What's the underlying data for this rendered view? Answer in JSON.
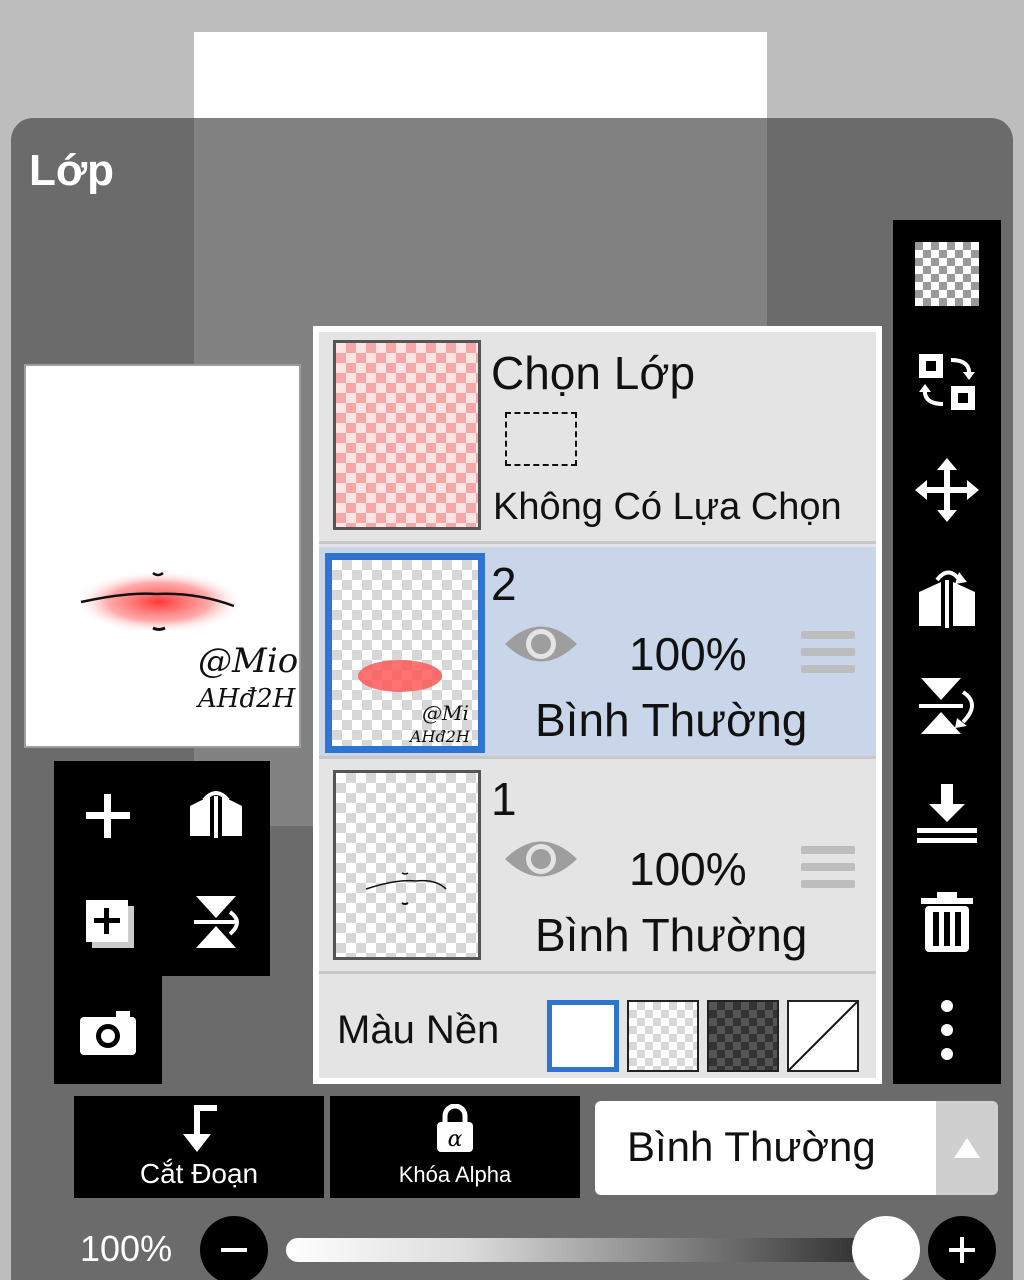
{
  "panel": {
    "title": "Lớp"
  },
  "layer_list": {
    "selection": {
      "title": "Chọn Lớp",
      "status": "Không Có Lựa Chọn"
    },
    "layers": [
      {
        "name": "2",
        "opacity": "100%",
        "blend": "Bình Thường",
        "selected": true
      },
      {
        "name": "1",
        "opacity": "100%",
        "blend": "Bình Thường",
        "selected": false
      }
    ],
    "background": {
      "label": "Màu Nền",
      "options": [
        "white",
        "transparent",
        "dark-checker",
        "none"
      ],
      "selected": "white"
    }
  },
  "preview": {
    "signature_line1": "@Mio",
    "signature_line2": "AHđ2H"
  },
  "left_tools": [
    "add-layer-icon",
    "flip-horizontal-icon",
    "add-copy-layer-icon",
    "flip-vertical-icon",
    "camera-icon"
  ],
  "right_tools": [
    "transparency-icon",
    "swap-icon",
    "move-icon",
    "flip-horizontal-icon",
    "flip-vertical-icon",
    "merge-down-icon",
    "trash-icon",
    "more-icon"
  ],
  "bottom": {
    "clip_label": "Cắt Đoạn",
    "alpha_lock_label": "Khóa Alpha",
    "blend_mode": "Bình Thường"
  },
  "opacity": {
    "label": "100%",
    "value": 1.0
  },
  "colors": {
    "selected_blue": "#2f74d0",
    "active_row": "#c9d6ea",
    "lip_red": "#ff3b3b"
  }
}
